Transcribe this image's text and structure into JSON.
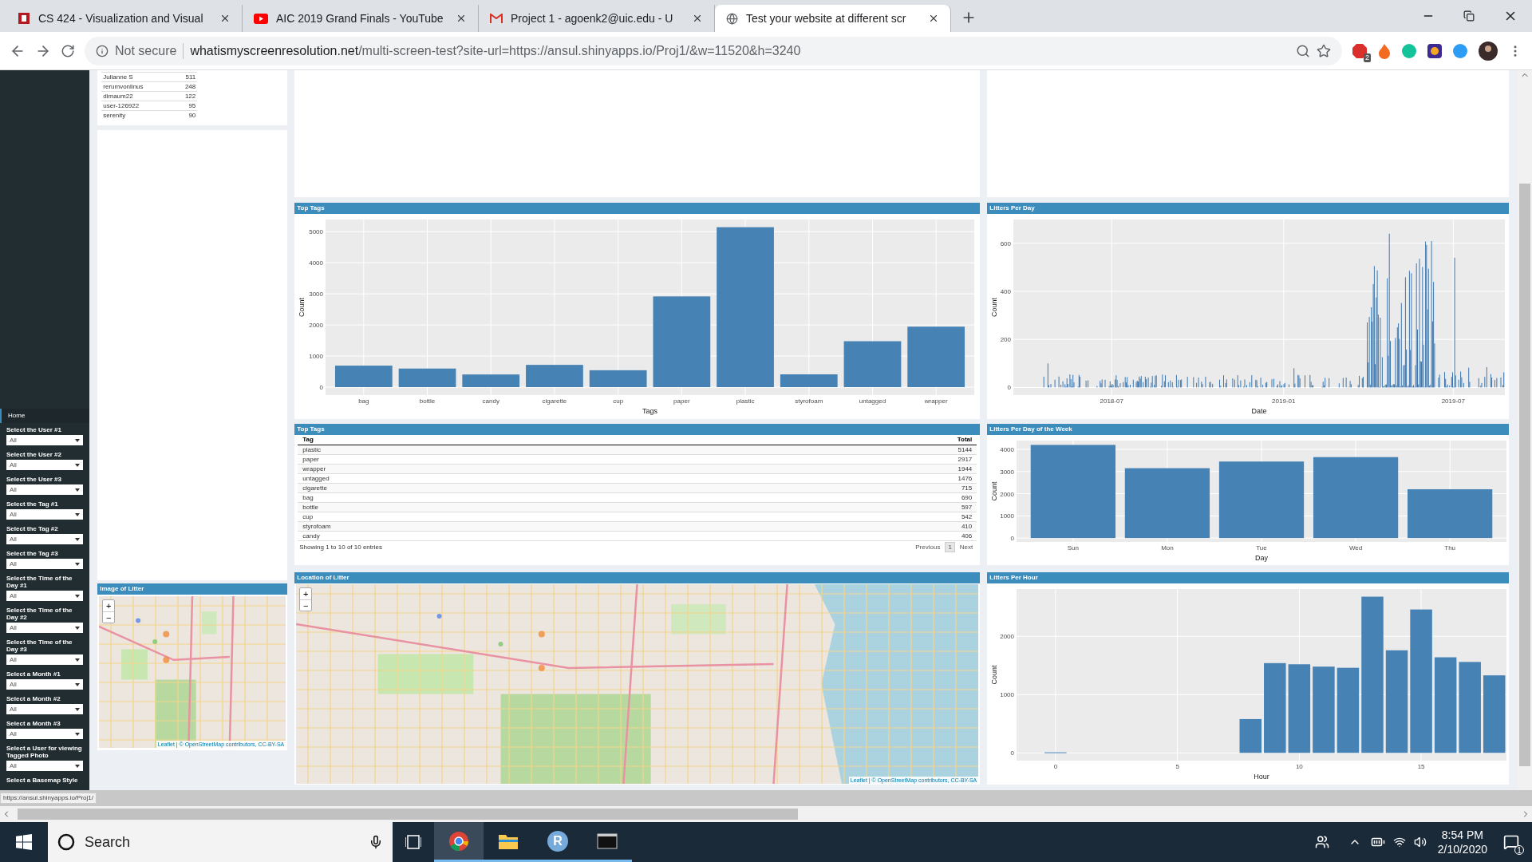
{
  "browser": {
    "tabs": [
      {
        "title": "CS 424 - Visualization and Visual",
        "kind": "course",
        "selected": false
      },
      {
        "title": "AIC 2019 Grand Finals - YouTube",
        "kind": "video",
        "selected": false
      },
      {
        "title": "Project 1 - agoenk2@uic.edu - U",
        "kind": "mail",
        "selected": false
      },
      {
        "title": "Test your website at different scr",
        "kind": "globe",
        "selected": true
      }
    ],
    "security": "Not secure",
    "url_host": "whatismyscreenresolution.net",
    "url_path": "/multi-screen-test?site-url=https://ansul.shinyapps.io/Proj1/&w=11520&h=3240",
    "extension_badge": "2",
    "status_url": "https://ansul.shinyapps.io/Proj1/"
  },
  "sidebar": {
    "items": [
      {
        "label": "Home",
        "selected": true
      }
    ],
    "selects": [
      {
        "label": "Select the User #1",
        "value": "All"
      },
      {
        "label": "Select the User #2",
        "value": "All"
      },
      {
        "label": "Select the User #3",
        "value": "All"
      },
      {
        "label": "Select the Tag #1",
        "value": "All"
      },
      {
        "label": "Select the Tag #2",
        "value": "All"
      },
      {
        "label": "Select the Tag #3",
        "value": "All"
      },
      {
        "label": "Select the Time of the Day #1",
        "value": "All"
      },
      {
        "label": "Select the Time of the Day #2",
        "value": "All"
      },
      {
        "label": "Select the Time of the Day #3",
        "value": "All"
      },
      {
        "label": "Select a Month #1",
        "value": "All"
      },
      {
        "label": "Select a Month #2",
        "value": "All"
      },
      {
        "label": "Select a Month #3",
        "value": "All"
      },
      {
        "label": "Select a User for viewing Tagged Photo",
        "value": "All"
      }
    ],
    "last_label": "Select a Basemap Style"
  },
  "top_users": {
    "rows": [
      {
        "user": "Julianne S",
        "count": "511"
      },
      {
        "user": "rerumvonlinus",
        "count": "248"
      },
      {
        "user": "dimaum22",
        "count": "122"
      },
      {
        "user": "user-126922",
        "count": "95"
      },
      {
        "user": "serenity",
        "count": "90"
      }
    ]
  },
  "image_of_litter": {
    "title": "Image of Litter",
    "zoom_in": "+",
    "zoom_out": "−",
    "attribution": "Leaflet | © OpenStreetMap contributors, CC-BY-SA"
  },
  "top_tags_chart": {
    "chart_data": {
      "type": "bar",
      "title": "Top Tags",
      "xlabel": "Tags",
      "ylabel": "Count",
      "categories": [
        "bag",
        "bottle",
        "candy",
        "cigarette",
        "cup",
        "paper",
        "plastic",
        "styrofoam",
        "untagged",
        "wrapper"
      ],
      "values": [
        690,
        597,
        406,
        715,
        542,
        2917,
        5144,
        410,
        1476,
        1944
      ],
      "ylim": [
        -257,
        5392
      ],
      "yticks": [
        0,
        1000,
        2000,
        3000,
        4000,
        5000
      ],
      "grid": true
    }
  },
  "litters_per_day": {
    "title": "Litters Per Day",
    "xlabel": "Date",
    "ylabel": "Count",
    "yticks": [
      "600",
      "400",
      "200",
      "0"
    ],
    "xticks": [
      "2018-07",
      "2019-01",
      "2019-07"
    ]
  },
  "top_tags_table": {
    "title": "Top Tags",
    "columns": [
      "Tag",
      "Total"
    ],
    "rows": [
      [
        "plastic",
        "5144"
      ],
      [
        "paper",
        "2917"
      ],
      [
        "wrapper",
        "1944"
      ],
      [
        "untagged",
        "1476"
      ],
      [
        "cigarette",
        "715"
      ],
      [
        "bag",
        "690"
      ],
      [
        "bottle",
        "597"
      ],
      [
        "cup",
        "542"
      ],
      [
        "styrofoam",
        "410"
      ],
      [
        "candy",
        "406"
      ]
    ],
    "info": "Showing 1 to 10 of 10 entries",
    "pagination": [
      {
        "label": "Previous",
        "selected": false
      },
      {
        "label": "1",
        "selected": true
      },
      {
        "label": "Next",
        "selected": false
      }
    ]
  },
  "litters_per_weekday": {
    "chart_data": {
      "type": "bar",
      "title": "Litters Per Day of the Week",
      "xlabel": "Day",
      "ylabel": "Count",
      "categories": [
        "Sun",
        "Mon",
        "Tue",
        "Wed",
        "Thu"
      ],
      "values": [
        4200,
        3150,
        3450,
        3650,
        2200
      ],
      "ylim": [
        -176,
        4395
      ],
      "yticks": [
        0,
        1000,
        2000,
        3000,
        4000
      ],
      "grid": true
    }
  },
  "location_map": {
    "title": "Location of Litter",
    "zoom_in": "+",
    "zoom_out": "−",
    "attribution": "Leaflet | © OpenStreetMap contributors, CC-BY-SA"
  },
  "litters_per_hour": {
    "chart_data": {
      "type": "bar",
      "title": "Litters Per Hour",
      "xlabel": "Hour",
      "ylabel": "Count",
      "x": [
        0,
        8,
        9,
        10,
        11,
        12,
        13,
        14,
        15,
        16,
        17,
        18
      ],
      "values": [
        10,
        580,
        1540,
        1520,
        1480,
        1460,
        2680,
        1760,
        2460,
        1640,
        1560,
        1330
      ],
      "xlim": [
        -1.6,
        18.5
      ],
      "ylim": [
        -133,
        2811
      ],
      "xticks": [
        0,
        5,
        10,
        15
      ],
      "yticks": [
        0,
        1000,
        2000
      ],
      "grid": true
    }
  },
  "taskbar": {
    "search_placeholder": "Search",
    "apps": [
      {
        "kind": "chrome",
        "selected": true
      },
      {
        "kind": "folder",
        "selected": false
      },
      {
        "kind": "r",
        "label": "R",
        "selected": false
      },
      {
        "kind": "terminal",
        "selected": false
      }
    ],
    "time": "8:54 PM",
    "date": "2/10/2020",
    "notifications": "1"
  }
}
